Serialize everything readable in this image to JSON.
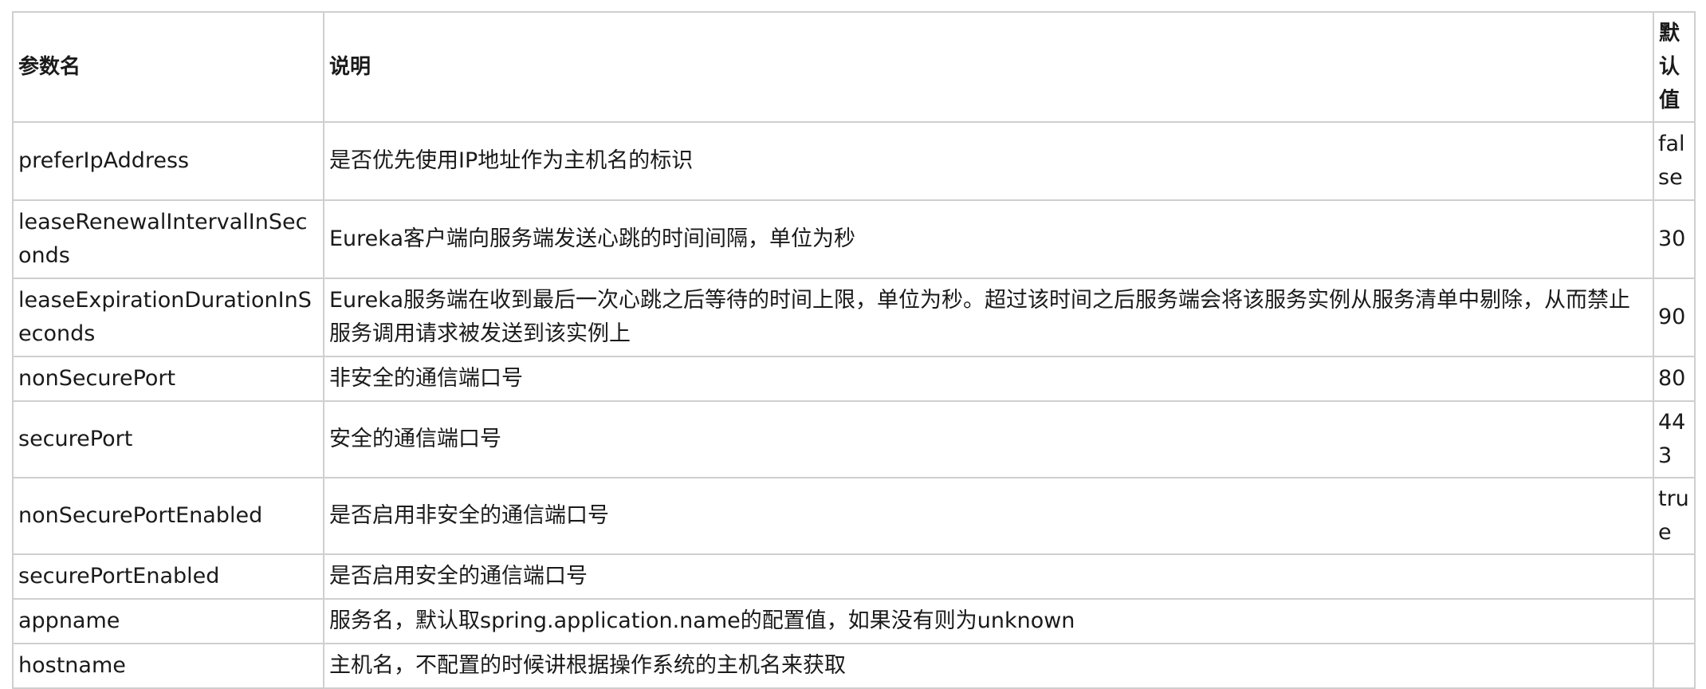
{
  "table": {
    "headers": {
      "name": "参数名",
      "desc": "说明",
      "default": "默认值"
    },
    "rows": [
      {
        "name": "preferIpAddress",
        "desc": "是否优先使用IP地址作为主机名的标识",
        "default": "false"
      },
      {
        "name": "leaseRenewalIntervalInSeconds",
        "desc": "Eureka客户端向服务端发送心跳的时间间隔，单位为秒",
        "default": "30"
      },
      {
        "name": "leaseExpirationDurationInSeconds",
        "desc": "Eureka服务端在收到最后一次心跳之后等待的时间上限，单位为秒。超过该时间之后服务端会将该服务实例从服务清单中剔除，从而禁止服务调用请求被发送到该实例上",
        "default": "90"
      },
      {
        "name": "nonSecurePort",
        "desc": "非安全的通信端口号",
        "default": "80"
      },
      {
        "name": "securePort",
        "desc": "安全的通信端口号",
        "default": "443"
      },
      {
        "name": "nonSecurePortEnabled",
        "desc": "是否启用非安全的通信端口号",
        "default": "true"
      },
      {
        "name": "securePortEnabled",
        "desc": "是否启用安全的通信端口号",
        "default": ""
      },
      {
        "name": "appname",
        "desc": "服务名，默认取spring.application.name的配置值，如果没有则为unknown",
        "default": ""
      },
      {
        "name": "hostname",
        "desc": "主机名，不配置的时候讲根据操作系统的主机名来获取",
        "default": ""
      }
    ]
  }
}
